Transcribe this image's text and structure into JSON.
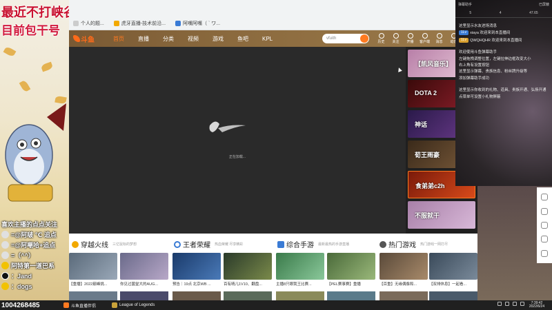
{
  "overlay": {
    "title_line1": "最近不打峡谷",
    "title_line2": "目前包干号",
    "chat_lines": [
      "喜欢主播的点点关注",
      "=@阿啵 ℃ 追点",
      "=@阿嘲哈+追点",
      "=（^^）",
      "阿特第一道巴系",
      "：Jand",
      "：dogs"
    ],
    "bottom_number": "1004268485"
  },
  "browser": {
    "tabs": [
      "个人的题...",
      "虎牙直播-技术前沿...",
      "阿嘴阿嘴（ ` ワ..."
    ],
    "bookmarks": [
      "个人的题...",
      "虎牙直播-技术前沿...",
      "阿嘴阿嘴（ ` ワ..."
    ]
  },
  "site": {
    "logo_text": "斗鱼",
    "nav": [
      "首页",
      "直播",
      "分类",
      "视频",
      "游戏",
      "鱼吧",
      "KPL"
    ],
    "search_placeholder": "vfuith",
    "header_icons": [
      {
        "label": "历史",
        "icon": "history-icon"
      },
      {
        "label": "关注",
        "icon": "heart-icon"
      },
      {
        "label": "开播",
        "icon": "camera-icon"
      },
      {
        "label": "客户端",
        "icon": "download-icon"
      },
      {
        "label": "消息",
        "icon": "bell-icon"
      },
      {
        "label": "动态",
        "icon": "dynamic-icon"
      },
      {
        "label": "我的",
        "icon": "user-icon"
      }
    ]
  },
  "player": {
    "loading_text": "正在加载..."
  },
  "recommendations": [
    {
      "label": "【凯风音乐】",
      "color": "#b87fa8"
    },
    {
      "label": "DOTA 2",
      "color": "#8a1e2a"
    },
    {
      "label": "神话",
      "color": "#4a2a6a"
    },
    {
      "label": "荀王雨豪",
      "color": "#5a3a2a"
    },
    {
      "label": "食弟弟c2h",
      "color": "#b83a1a"
    },
    {
      "label": "不服就干",
      "color": "#c9a0c8"
    }
  ],
  "categories": [
    {
      "title": "穿越火线",
      "subtitle": "三亿鼠标的梦想",
      "color": "#f2a900"
    },
    {
      "title": "王者荣耀",
      "subtitle": "热血荣耀 尽享精彩",
      "color": "#3a7bd5"
    },
    {
      "title": "综合手游",
      "subtitle": "最新最热的手游直播",
      "color": "#3a7bd5"
    },
    {
      "title": "热门游戏",
      "subtitle": "热门游戏一网打尽",
      "color": "#555555"
    }
  ],
  "thumbs": [
    {
      "caption": "【重播】2022巅峰挑...",
      "color": "#6a7a8a"
    },
    {
      "caption": "你见过菌堂大的AUG...",
      "color": "#8a8a9a"
    },
    {
      "caption": "预告｜19点 北京WB ...",
      "color": "#2a5a8a"
    },
    {
      "caption": "百有晴儿1V10、翻盘...",
      "color": "#4a6a3a"
    },
    {
      "caption": "主播8只眼我王比赛...",
      "color": "#4a8a5a"
    },
    {
      "caption": "【PEL赛事赛】重播",
      "color": "#5a7a4a"
    },
    {
      "caption": "【百重】无缘偶像和...",
      "color": "#7a5a3a"
    },
    {
      "caption": "【双排休息】一起看...",
      "color": "#5a6a7a"
    }
  ],
  "chat_panel": {
    "header_left": "弹幕助手",
    "header_right": "已屏蔽",
    "stats": [
      "5",
      "4",
      "47.65"
    ],
    "messages": [
      {
        "badge": "",
        "text": "这里显示水友进场消息"
      },
      {
        "badge": "1Lv",
        "text": "xiaya 欢迎来到本直播间"
      },
      {
        "badge": "1Lv",
        "text": "QWQHQHR 欢迎来到本直播间"
      },
      {
        "badge": "",
        "text": ""
      },
      {
        "badge": "",
        "text": "欢迎使用斗鱼弹幕助手"
      },
      {
        "badge": "",
        "text": "左键拖拽调整位置，左键拉伸边框改变大小"
      },
      {
        "badge": "",
        "text": "右上角有设置按钮"
      },
      {
        "badge": "",
        "text": "这里显示弹幕、贵族信息、粉丝牌升级等"
      },
      {
        "badge": "",
        "text": "添加弹幕助手成功"
      },
      {
        "badge": "",
        "text": ""
      },
      {
        "badge": "",
        "text": "这里显示你收到的礼物、道具、贵族开通、弘扬开通"
      },
      {
        "badge": "",
        "text": "点菜单可设置小礼物屏蔽"
      }
    ]
  },
  "taskbar": {
    "apps": [
      "斗鱼直播伴侣",
      "League of Legends"
    ],
    "time": "7:39:42",
    "date": "2022/6/24"
  }
}
